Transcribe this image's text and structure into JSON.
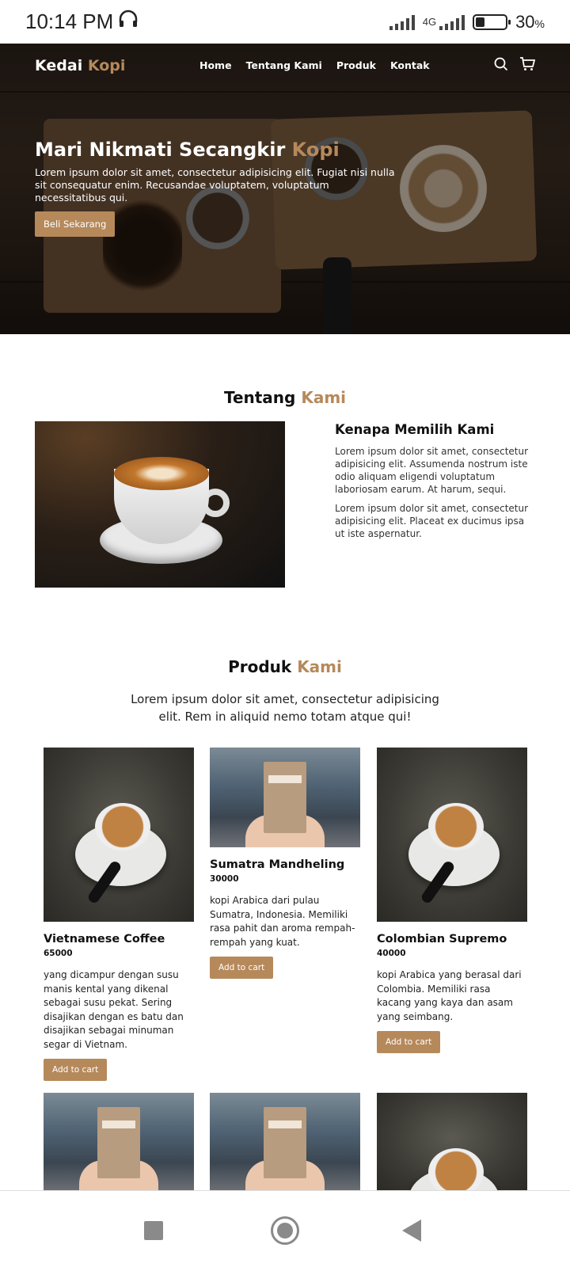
{
  "status": {
    "time": "10:14 PM",
    "network": "4G",
    "battery": "30",
    "battery_unit": "%",
    "battery_level": 0.3
  },
  "nav": {
    "logo_a": "Kedai",
    "logo_b": "Kopi",
    "links": [
      "Home",
      "Tentang Kami",
      "Produk",
      "Kontak"
    ]
  },
  "hero": {
    "title_a": "Mari Nikmati Secangkir",
    "title_b": "Kopi",
    "text": "Lorem ipsum dolor sit amet, consectetur adipisicing elit. Fugiat nisi nulla sit consequatur enim. Recusandae voluptatem, voluptatum necessitatibus qui.",
    "cta": "Beli Sekarang"
  },
  "about": {
    "title_a": "Tentang",
    "title_b": "Kami",
    "heading": "Kenapa Memilih Kami",
    "p1": "Lorem ipsum dolor sit amet, consectetur adipisicing elit. Assumenda nostrum iste odio aliquam eligendi voluptatum laboriosam earum. At harum, sequi.",
    "p2": "Lorem ipsum dolor sit amet, consectetur adipisicing elit. Placeat ex ducimus ipsa ut iste aspernatur."
  },
  "products": {
    "title_a": "Produk",
    "title_b": "Kami",
    "intro": "Lorem ipsum dolor sit amet, consectetur adipisicing elit. Rem in aliquid nemo totam atque qui!",
    "items": [
      {
        "name": "Vietnamese Coffee",
        "price": "65000",
        "desc": "yang dicampur dengan susu manis kental yang dikenal sebagai susu pekat. Sering disajikan dengan es batu dan disajikan sebagai minuman segar di Vietnam.",
        "button": "Add to cart"
      },
      {
        "name": "Sumatra Mandheling",
        "price": "30000",
        "desc": "kopi Arabica dari pulau Sumatra, Indonesia. Memiliki rasa pahit dan aroma rempah-rempah yang kuat.",
        "button": "Add to cart"
      },
      {
        "name": "Colombian Supremo",
        "price": "40000",
        "desc": "kopi Arabica yang berasal dari Colombia. Memiliki rasa kacang yang kaya dan asam yang seimbang.",
        "button": "Add to cart"
      }
    ]
  }
}
